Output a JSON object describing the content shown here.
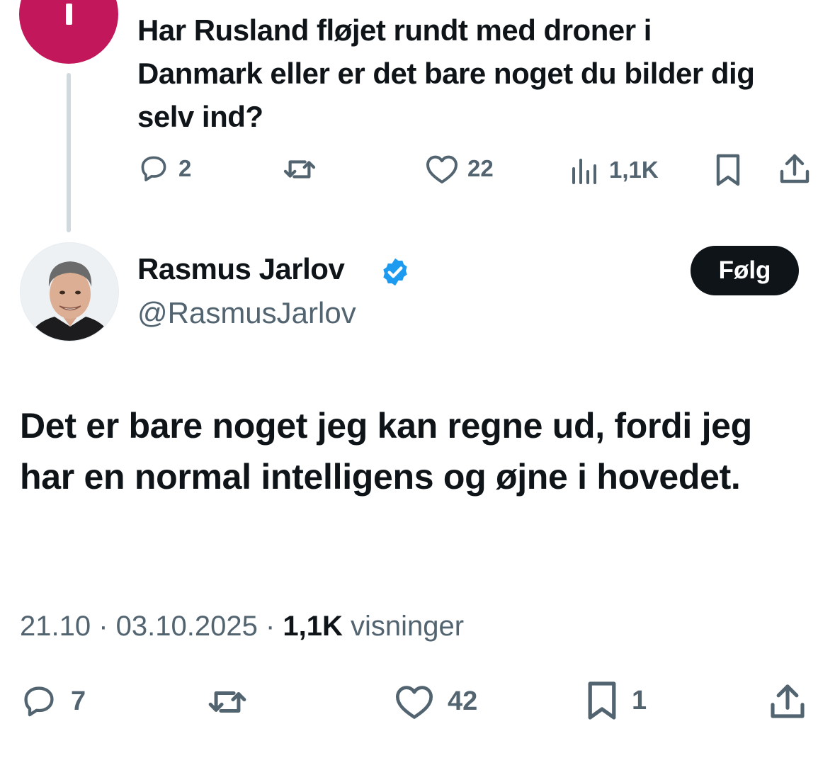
{
  "parent_tweet": {
    "text": "Har Rusland fløjet rundt med droner i Danmark eller er det bare noget du bilder dig selv ind?",
    "actions": {
      "replies": {
        "icon": "reply-icon",
        "count": "2"
      },
      "retweets": {
        "icon": "retweet-icon",
        "count": ""
      },
      "likes": {
        "icon": "heart-icon",
        "count": "22"
      },
      "views": {
        "icon": "views-icon",
        "count": "1,1K"
      },
      "bookmark": {
        "icon": "bookmark-icon"
      },
      "share": {
        "icon": "share-icon"
      }
    },
    "avatar_color": "#c2185b"
  },
  "tweet": {
    "author": {
      "name": "Rasmus Jarlov",
      "handle": "@RasmusJarlov",
      "verified": true,
      "verified_color": "#1d9bf0"
    },
    "follow_label": "Følg",
    "text": "Det er bare noget jeg kan regne ud, fordi jeg har en normal intelligens og øjne i hovedet.",
    "meta": {
      "time": "21.10",
      "separator": " · ",
      "date": "03.10.2025",
      "views_count": "1,1K",
      "views_label": " visninger"
    },
    "actions": {
      "replies": {
        "icon": "reply-icon",
        "count": "7"
      },
      "retweets": {
        "icon": "retweet-icon",
        "count": ""
      },
      "likes": {
        "icon": "heart-icon",
        "count": "42"
      },
      "bookmarks": {
        "icon": "bookmark-icon",
        "count": "1"
      },
      "share": {
        "icon": "share-icon"
      }
    }
  },
  "colors": {
    "text_primary": "#0f1419",
    "text_secondary": "#536471",
    "thread_line": "#cfd9de",
    "button_bg": "#0f1419",
    "button_text": "#ffffff"
  }
}
